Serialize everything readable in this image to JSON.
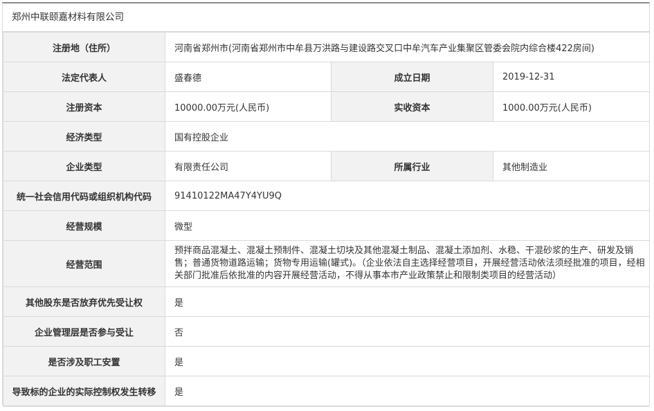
{
  "company_name": "郑州中联颐嘉材料有限公司",
  "fields": {
    "address_label": "注册地（住所）",
    "address_value": "河南省郑州市(河南省郑州市中牟县万洪路与建设路交叉口中牟汽车产业集聚区管委会院内综合楼422房间)",
    "legal_rep_label": "法定代表人",
    "legal_rep_value": "盛春德",
    "established_label": "成立日期",
    "established_value": "2019-12-31",
    "reg_capital_label": "注册资本",
    "reg_capital_value": "10000.00万元(人民币)",
    "paid_capital_label": "实收资本",
    "paid_capital_value": "1000.00万元(人民币)",
    "economy_type_label": "经济类型",
    "economy_type_value": "国有控股企业",
    "enterprise_type_label": "企业类型",
    "enterprise_type_value": "有限责任公司",
    "industry_label": "所属行业",
    "industry_value": "其他制造业",
    "credit_code_label": "统一社会信用代码或组织机构代码",
    "credit_code_value": "91410122MA47Y4YU9Q",
    "scale_label": "经营规模",
    "scale_value": "微型",
    "scope_label": "经营范围",
    "scope_value": "预拌商品混凝土、混凝土预制件、混凝土切块及其他混凝土制品、混凝土添加剂、水稳、干混砂浆的生产、研发及销售；普通货物道路运输；货物专用运输(罐式)。（企业依法自主选择经营项目，开展经营活动依法须经批准的项目，经相关部门批准后依批准的内容开展经营活动，不得从事本市产业政策禁止和限制类项目的经营活动）",
    "waiver_label": "其他股东是否放弃优先受让权",
    "waiver_value": "是",
    "mgmt_label": "企业管理层是否参与受让",
    "mgmt_value": "否",
    "staff_label": "是否涉及职工安置",
    "staff_value": "是",
    "control_label": "导致标的企业的实际控制权发生转移",
    "control_value": "是"
  }
}
